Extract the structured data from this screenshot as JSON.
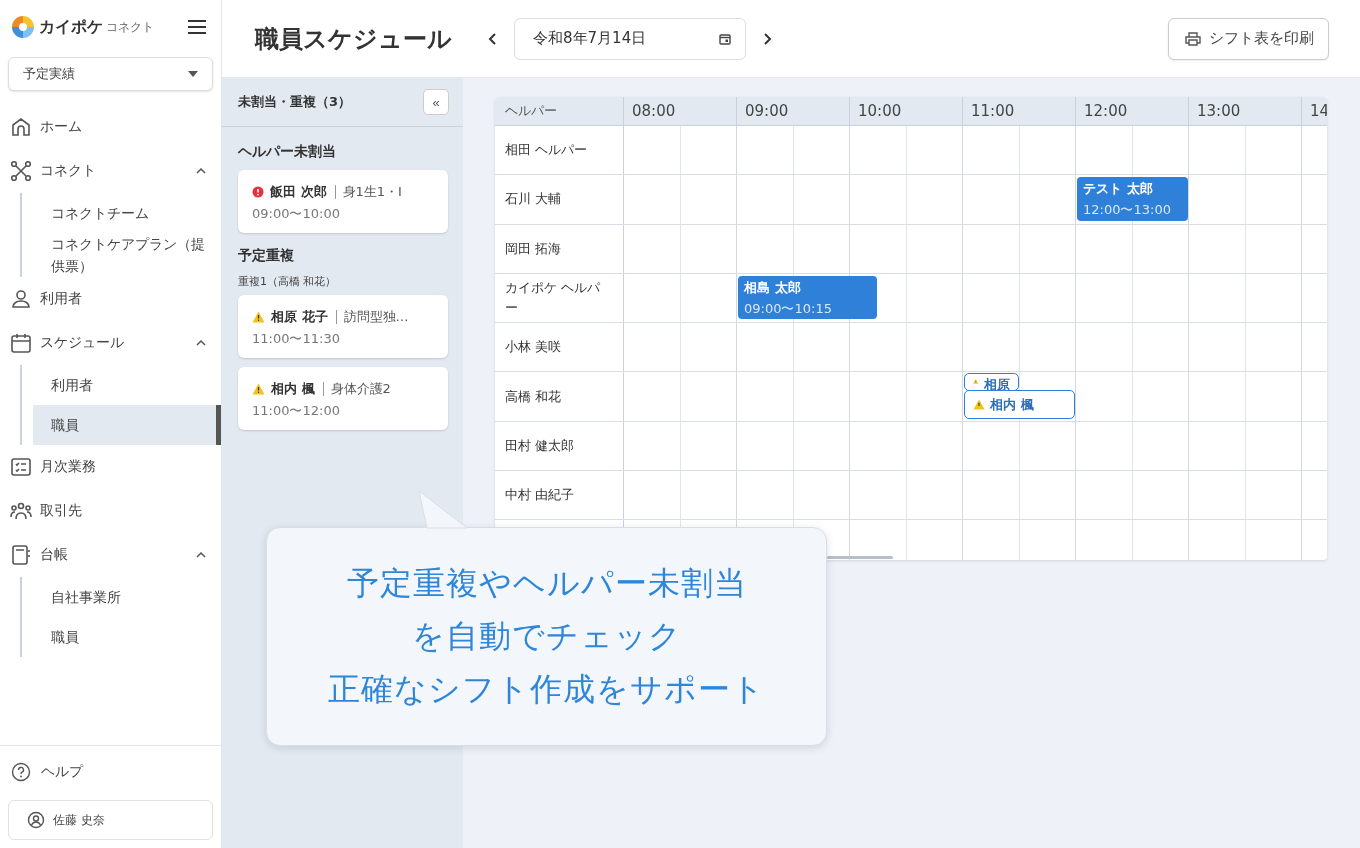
{
  "sidebar": {
    "logo": {
      "brand": "カイポケ",
      "product": "コネクト"
    },
    "mode_select": {
      "value": "予定実績"
    },
    "nav": [
      {
        "label": "ホーム",
        "kind": "item",
        "selected": false
      },
      {
        "label": "コネクト",
        "kind": "group",
        "expanded": true,
        "children": [
          {
            "label": "コネクトチーム",
            "selected": false
          },
          {
            "label": "コネクトケアプラン（提供票）",
            "selected": false
          }
        ]
      },
      {
        "label": "利用者",
        "kind": "item",
        "selected": false
      },
      {
        "label": "スケジュール",
        "kind": "group",
        "expanded": true,
        "children": [
          {
            "label": "利用者",
            "selected": false
          },
          {
            "label": "職員",
            "selected": true
          }
        ]
      },
      {
        "label": "月次業務",
        "kind": "item",
        "selected": false
      },
      {
        "label": "取引先",
        "kind": "item",
        "selected": false
      },
      {
        "label": "台帳",
        "kind": "group",
        "expanded": true,
        "children": [
          {
            "label": "自社事業所",
            "selected": false
          },
          {
            "label": "職員",
            "selected": false
          }
        ]
      }
    ],
    "help": "ヘルプ",
    "user": "佐藤 史奈"
  },
  "header": {
    "title": "職員スケジュール",
    "date": "令和8年7月14日",
    "print_button": "シフト表を印刷"
  },
  "issues_panel": {
    "title": "未割当・重複（3）",
    "collapse_button": "«",
    "sections": [
      {
        "heading": "ヘルパー未割当",
        "groups": [
          {
            "cards": [
              {
                "kind": "unassigned",
                "name": "飯田 次郎",
                "service": "身1生1・Ⅰ",
                "time": "09:00〜10:00"
              }
            ]
          }
        ]
      },
      {
        "heading": "予定重複",
        "groups": [
          {
            "label": "重複1（高橋 和花）",
            "cards": [
              {
                "kind": "overlap",
                "name": "相原 花子",
                "service": "訪問型独…",
                "time": "11:00〜11:30"
              },
              {
                "kind": "overlap",
                "name": "相内 楓",
                "service": "身体介護2",
                "time": "11:00〜12:00"
              }
            ]
          }
        ]
      }
    ]
  },
  "schedule": {
    "helper_column": "ヘルパー",
    "hours": [
      "08:00",
      "09:00",
      "10:00",
      "11:00",
      "12:00",
      "13:00",
      "14"
    ],
    "rows": [
      {
        "helper": "相田 ヘルパー",
        "events": []
      },
      {
        "helper": "石川 大輔",
        "events": [
          {
            "kind": "block",
            "name": "テスト 太郎",
            "time": "12:00〜13:00"
          }
        ]
      },
      {
        "helper": "岡田 拓海",
        "events": []
      },
      {
        "helper": "カイポケ ヘルパー",
        "events": [
          {
            "kind": "block",
            "name": "相島 太郎",
            "time": "09:00〜10:15"
          }
        ]
      },
      {
        "helper": "小林 美咲",
        "events": []
      },
      {
        "helper": "高橋 和花",
        "events": [
          {
            "kind": "chip",
            "name": "相原"
          },
          {
            "kind": "chip",
            "name": "相内 楓"
          }
        ]
      },
      {
        "helper": "田村 健太郎",
        "events": []
      },
      {
        "helper": "中村 由紀子",
        "events": []
      }
    ]
  },
  "callout": {
    "lines": [
      "予定重複やヘルパー未割当",
      "を自動でチェック",
      "正確なシフト作成をサポート"
    ]
  }
}
